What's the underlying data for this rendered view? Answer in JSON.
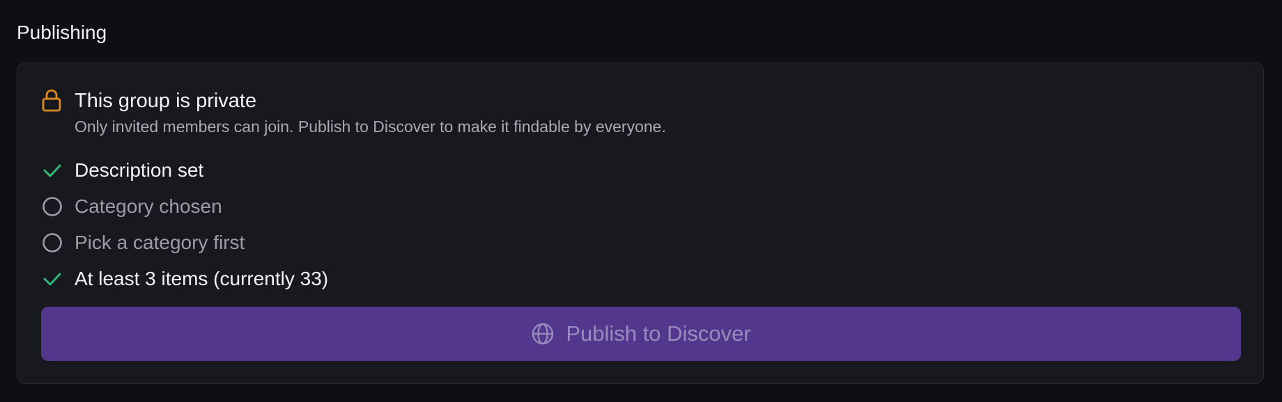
{
  "section": {
    "title": "Publishing"
  },
  "privacy": {
    "icon": "lock-icon",
    "title": "This group is private",
    "description": "Only invited members can join. Publish to Discover to make it findable by everyone.",
    "icon_color": "#e08a1e"
  },
  "checklist": [
    {
      "label": "Description set",
      "done": true,
      "icon": "check-icon"
    },
    {
      "label": "Category chosen",
      "done": false,
      "icon": "empty-circle-icon"
    },
    {
      "label": "Pick a category first",
      "done": false,
      "icon": "empty-circle-icon"
    },
    {
      "label": "At least 3 items (currently 33)",
      "done": true,
      "icon": "check-icon"
    }
  ],
  "publish_button": {
    "label": "Publish to Discover",
    "icon": "globe-icon",
    "disabled": true,
    "color": "#52378c"
  },
  "colors": {
    "check": "#2fbf7a",
    "circle": "#9c9da6",
    "background": "#0e0e13",
    "card": "#18191e"
  }
}
